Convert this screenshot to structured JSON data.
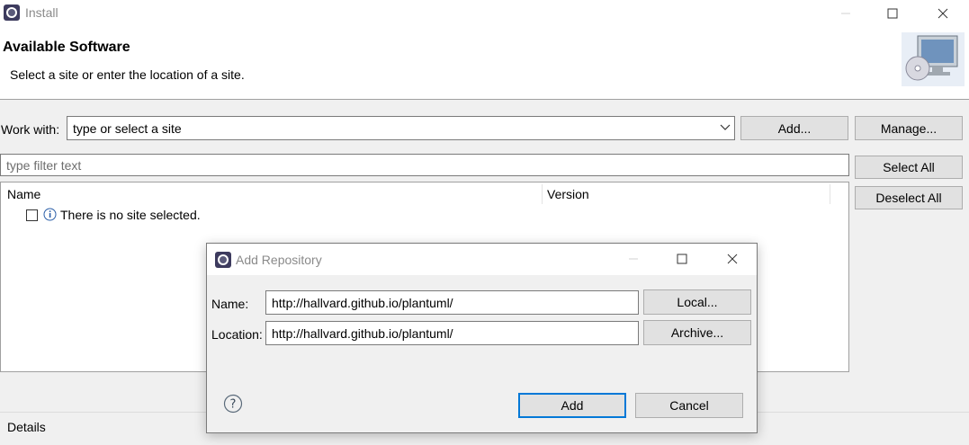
{
  "window": {
    "title": "Install"
  },
  "header": {
    "title": "Available Software",
    "subtitle": "Select a site or enter the location of a site."
  },
  "work_with": {
    "label": "Work with:",
    "value": "type or select a site",
    "add_label": "Add...",
    "manage_label": "Manage..."
  },
  "filter": {
    "placeholder": "type filter text"
  },
  "actions": {
    "select_all": "Select All",
    "deselect_all": "Deselect All"
  },
  "table": {
    "columns": [
      "Name",
      "Version"
    ],
    "rows": [
      {
        "text": "There is no site selected.",
        "checked": false,
        "icon": "info-icon"
      }
    ]
  },
  "details": {
    "label": "Details"
  },
  "dialog": {
    "title": "Add Repository",
    "name_label": "Name:",
    "name_value": "http://hallvard.github.io/plantuml/",
    "location_label": "Location:",
    "location_value": "http://hallvard.github.io/plantuml/",
    "local_label": "Local...",
    "archive_label": "Archive...",
    "add_label": "Add",
    "cancel_label": "Cancel",
    "help_icon": "help-icon"
  },
  "colors": {
    "focus_border": "#0078d7",
    "button_bg": "#e1e1e1"
  }
}
